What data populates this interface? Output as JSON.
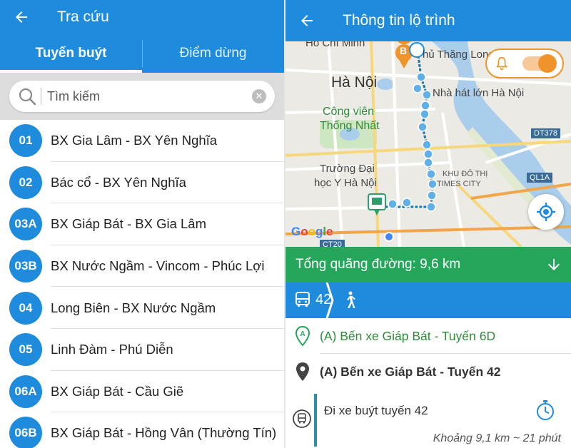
{
  "left": {
    "header": {
      "title": "Tra cứu",
      "back_icon": "arrow-left-icon"
    },
    "tabs": [
      {
        "label": "Tuyến buýt",
        "active": true
      },
      {
        "label": "Điểm dừng",
        "active": false
      }
    ],
    "search": {
      "placeholder": "Tìm kiếm",
      "value": ""
    },
    "routes": [
      {
        "code": "01",
        "name": "BX Gia Lâm - BX Yên Nghĩa"
      },
      {
        "code": "02",
        "name": "Bác cổ - BX Yên Nghĩa"
      },
      {
        "code": "03A",
        "name": "BX Giáp Bát - BX Gia Lâm"
      },
      {
        "code": "03B",
        "name": "BX Nước Ngầm - Vincom - Phúc Lợi"
      },
      {
        "code": "04",
        "name": "Long Biên - BX Nước Ngầm"
      },
      {
        "code": "05",
        "name": "Linh Đàm - Phú Diễn"
      },
      {
        "code": "06A",
        "name": "BX Giáp Bát - Cầu Giẽ"
      },
      {
        "code": "06B",
        "name": "BX Giáp Bát - Hồng Vân (Thường Tín)"
      }
    ]
  },
  "right": {
    "header": {
      "title": "Thông tin lộ trình",
      "back_icon": "arrow-left-icon"
    },
    "map": {
      "labels": {
        "ho_chi_minh": "Hồ Chí Minh",
        "thang_long": "hủ Thăng Long",
        "ha_noi": "Hà Nội",
        "opera": "Nhà hát lớn Hà Nội",
        "park_1": "Công viên",
        "park_2": "Thống Nhất",
        "uni_1": "Trường Đại",
        "uni_2": "học Y Hà Nội",
        "times_1": "KHU ĐÔ THỊ",
        "times_2": "TIMES CITY",
        "dt378": "DT378",
        "ql1a": "QL1A",
        "ct20": "CT20",
        "marker_b": "B"
      },
      "google": {
        "g1": "G",
        "g2": "o",
        "g3": "o",
        "g4": "g",
        "g5": "l",
        "g6": "e"
      },
      "alert_enabled": true
    },
    "distance": {
      "label": "Tổng quãng đường: 9,6 km"
    },
    "mode": {
      "bus_number": "42"
    },
    "stops": {
      "a": "(A) Bến xe Giáp Bát - Tuyến 6D",
      "b": "(A) Bến xe Giáp Bát - Tuyến 42"
    },
    "segment": {
      "instruction": "Đi xe buýt tuyến 42",
      "meta": "Khoảng 9,1 km ~ 21 phút"
    },
    "colors": {
      "primary": "#1f8bdd",
      "green": "#26a65b",
      "orange": "#f0932b",
      "route": "#2e8fa8"
    }
  }
}
